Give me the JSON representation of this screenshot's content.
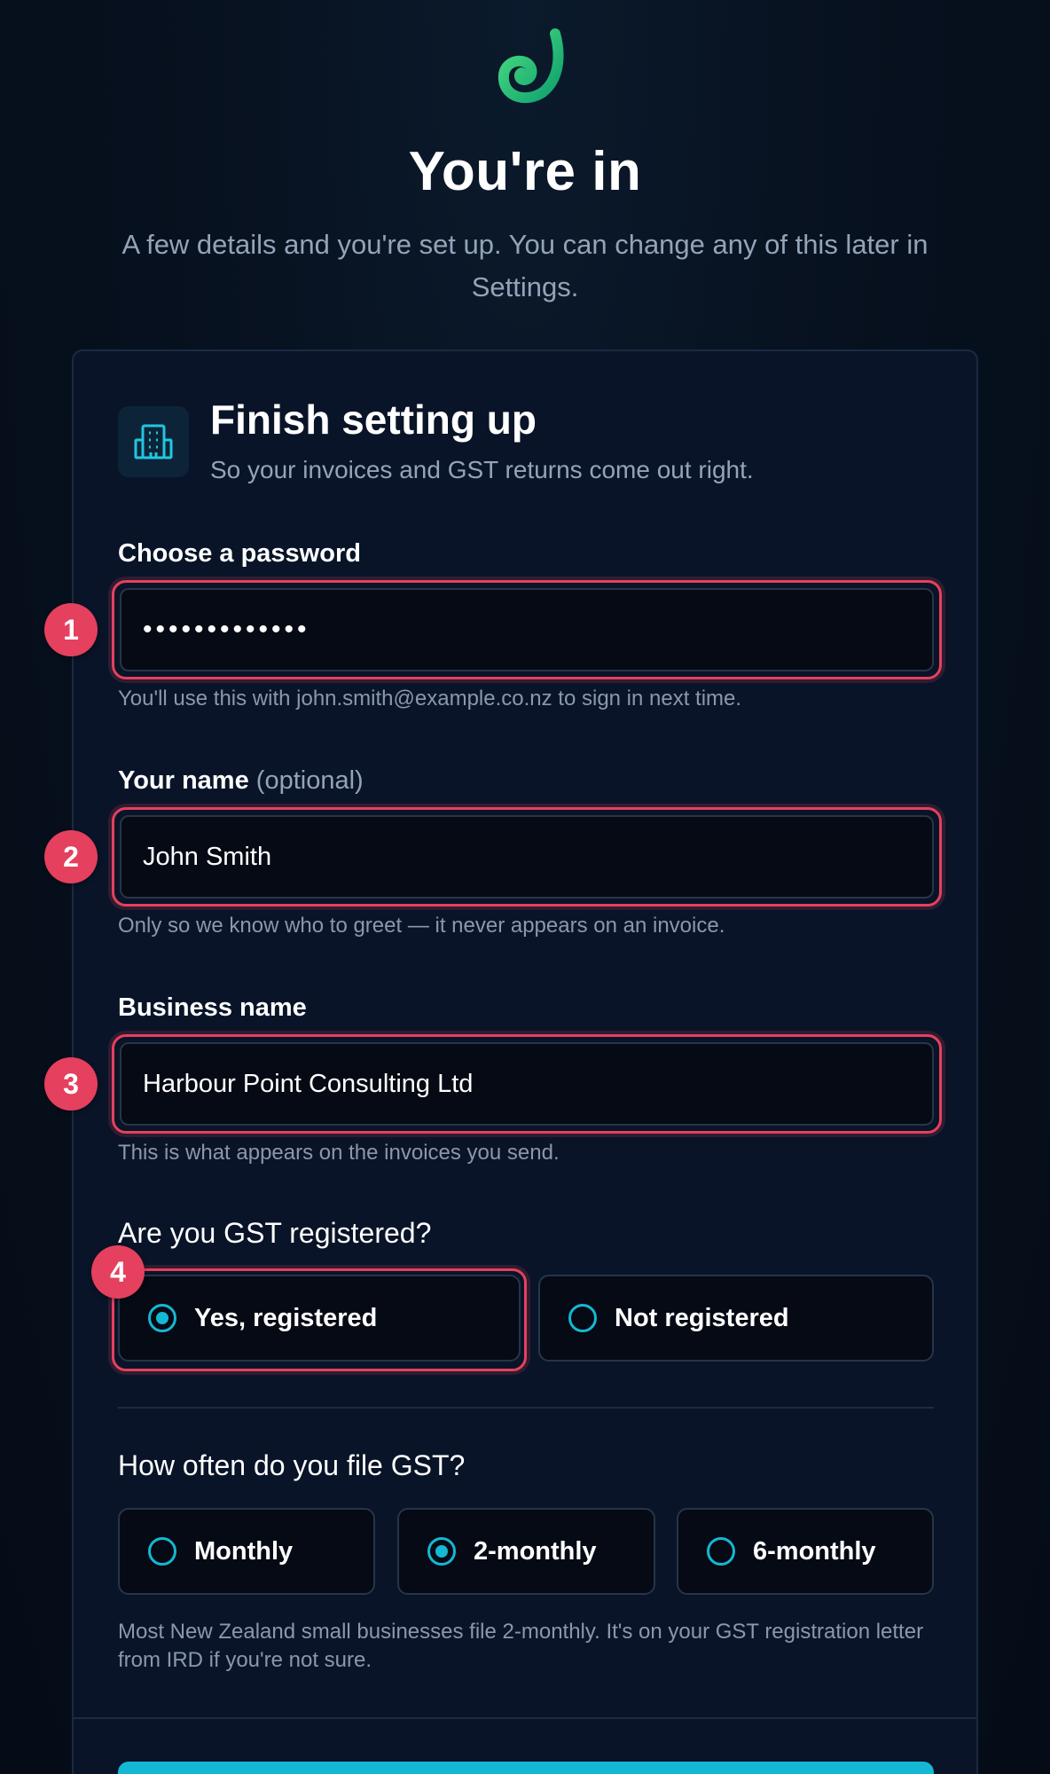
{
  "header": {
    "title": "You're in",
    "subtitle": "A few details and you're set up. You can change any of this later in Settings."
  },
  "card": {
    "icon": "building-icon",
    "title": "Finish setting up",
    "subtitle": "So your invoices and GST returns come out right."
  },
  "password": {
    "label": "Choose a password",
    "value": "•••••••••••••",
    "help": "You'll use this with john.smith@example.co.nz to sign in next time.",
    "marker": "1"
  },
  "name": {
    "label": "Your name",
    "optional": "(optional)",
    "value": "John Smith",
    "help": "Only so we know who to greet — it never appears on an invoice.",
    "marker": "2"
  },
  "business": {
    "label": "Business name",
    "value": "Harbour Point Consulting Ltd",
    "help": "This is what appears on the invoices you send.",
    "marker": "3"
  },
  "gst_registered": {
    "question": "Are you GST registered?",
    "marker": "4",
    "options": [
      {
        "label": "Yes, registered",
        "selected": true
      },
      {
        "label": "Not registered",
        "selected": false
      }
    ]
  },
  "gst_frequency": {
    "question": "How often do you file GST?",
    "options": [
      {
        "label": "Monthly",
        "selected": false
      },
      {
        "label": "2-monthly",
        "selected": true
      },
      {
        "label": "6-monthly",
        "selected": false
      }
    ],
    "help": "Most New Zealand small businesses file 2-monthly. It's on your GST registration letter from IRD if you're not sure."
  },
  "colors": {
    "accent": "#14b8d4",
    "highlight": "#e5405e",
    "logo": "#22c55e"
  }
}
